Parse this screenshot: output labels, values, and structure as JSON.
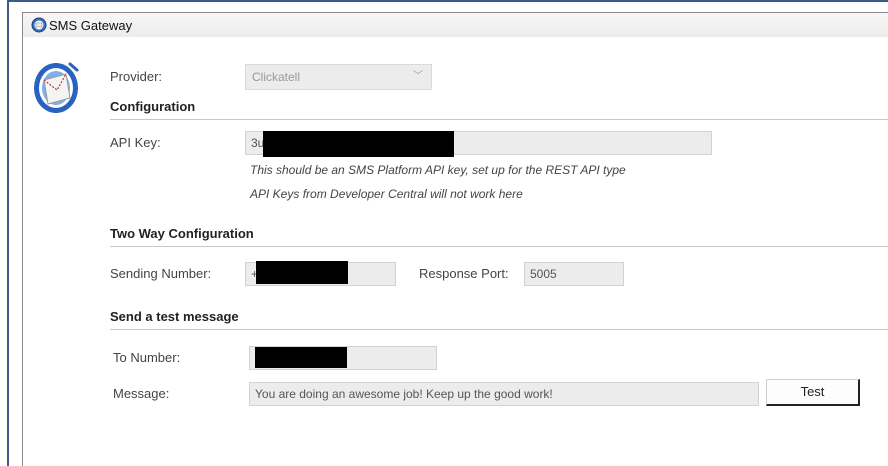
{
  "window": {
    "title": "SMS Gateway"
  },
  "provider": {
    "label": "Provider:",
    "value": "Clickatell"
  },
  "configuration": {
    "heading": "Configuration",
    "api_key_label": "API Key:",
    "api_key_value": "3u",
    "note_line1": "This should be an SMS Platform API key, set up for the REST API type",
    "note_line2": "API Keys from Developer Central will not work here"
  },
  "two_way": {
    "heading": "Two Way Configuration",
    "sending_number_label": "Sending Number:",
    "sending_number_value": "+1",
    "response_port_label": "Response Port:",
    "response_port_value": "5005"
  },
  "test_message": {
    "heading": "Send a test message",
    "to_number_label": "To Number:",
    "to_number_value": "",
    "message_label": "Message:",
    "message_value": "You are doing an awesome job! Keep up the good work!",
    "test_button": "Test"
  },
  "icons": {
    "title_icon": "sms-gateway-icon",
    "app_icon": "sms-gateway-logo-icon",
    "combo_arrow": "chevron-down-icon"
  },
  "colors": {
    "window_border": "#3c5a88",
    "field_bg": "#ececec",
    "heading_text": "#222222"
  }
}
